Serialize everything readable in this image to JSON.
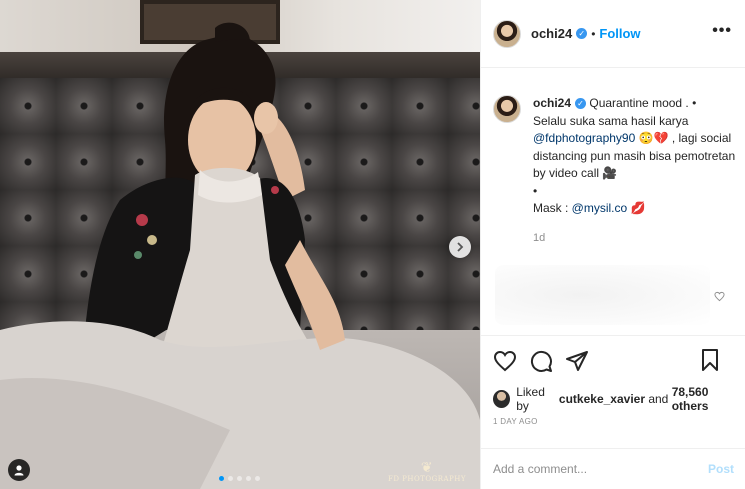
{
  "post": {
    "username": "ochi24",
    "follow_label": "Follow",
    "dot_separator": "•",
    "more_label": "•••"
  },
  "caption": {
    "username": "ochi24",
    "line1": "Quarantine mood . •",
    "line2": "Selalu suka sama hasil karya",
    "mention1": "@fdphotography90",
    "line3_emoji": " 😳💔",
    "line3_rest": " , lagi social distancing pun masih bisa pemotretan by video call 🎥",
    "bullet": "•",
    "mask_label": "Mask : ",
    "mention2": "@mysil.co",
    "mask_emoji": " 💋",
    "time": "1d"
  },
  "likes": {
    "prefix": "Liked by ",
    "user": "cutkeke_xavier",
    "middle": " and ",
    "count": "78,560 others"
  },
  "date": "1 DAY AGO",
  "comment": {
    "placeholder": "Add a comment...",
    "post_label": "Post"
  },
  "photo": {
    "watermark": "FD PHOTOGRAPHY",
    "carousel_dots": 5,
    "active_dot": 0
  },
  "colors": {
    "accent": "#0095f6",
    "verified": "#3897f0",
    "mention": "#00376b",
    "muted": "#8e8e8e"
  }
}
